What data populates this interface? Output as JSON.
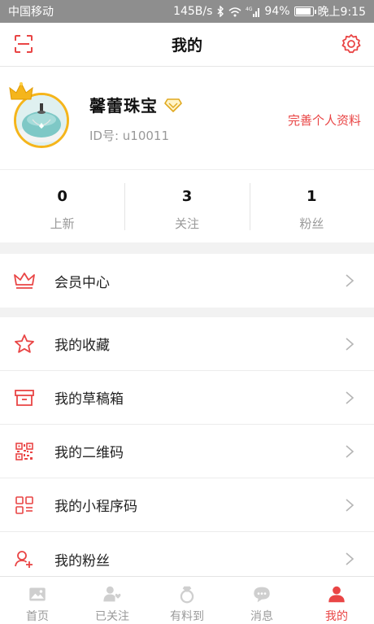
{
  "status_bar": {
    "carrier": "中国移动",
    "speed": "145B/s",
    "battery": "94%",
    "time": "晚上9:15",
    "battery_level": 0.94
  },
  "nav": {
    "title": "我的"
  },
  "profile": {
    "name": "馨蕾珠宝",
    "id_text": "ID号: u10011",
    "edit_link": "完善个人资料"
  },
  "stats": [
    {
      "value": "0",
      "label": "上新"
    },
    {
      "value": "3",
      "label": "关注"
    },
    {
      "value": "1",
      "label": "粉丝"
    }
  ],
  "menu": {
    "member": {
      "label": "会员中心",
      "icon": "crown-icon"
    },
    "items": [
      {
        "label": "我的收藏",
        "icon": "star-icon"
      },
      {
        "label": "我的草稿箱",
        "icon": "archive-box-icon"
      },
      {
        "label": "我的二维码",
        "icon": "qr-code-icon"
      },
      {
        "label": "我的小程序码",
        "icon": "mini-program-code-icon"
      },
      {
        "label": "我的粉丝",
        "icon": "user-plus-icon"
      }
    ]
  },
  "tabbar": [
    {
      "label": "首页",
      "icon": "image-icon",
      "active": false
    },
    {
      "label": "已关注",
      "icon": "users-heart-icon",
      "active": false
    },
    {
      "label": "有料到",
      "icon": "ring-icon",
      "active": false
    },
    {
      "label": "消息",
      "icon": "chat-bubble-icon",
      "active": false
    },
    {
      "label": "我的",
      "icon": "user-icon",
      "active": true
    }
  ],
  "colors": {
    "accent": "#e94545",
    "crown": "#f5b51b",
    "status_bar": "#8e8e8e",
    "tab_inactive": "#9a9a9a"
  }
}
